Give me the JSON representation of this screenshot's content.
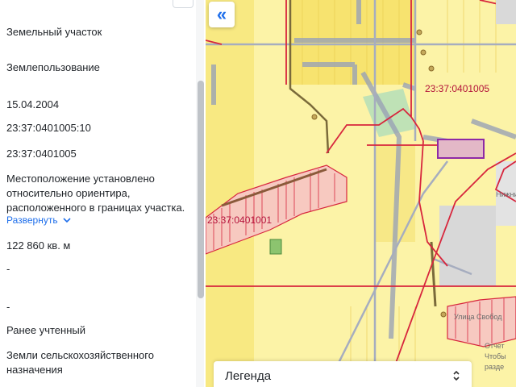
{
  "info_panel": {
    "fields": [
      {
        "value": "Земельный участок"
      },
      {
        "value": "Землепользование"
      },
      {
        "value": "15.04.2004"
      },
      {
        "value": "23:37:0401005:10"
      },
      {
        "value": "23:37:0401005"
      },
      {
        "value": "Местоположение установлено относительно ориентира, расположенного в границах участка."
      },
      {
        "value": "122 860 кв. м"
      },
      {
        "value": "-"
      },
      {
        "value": "-"
      },
      {
        "value": "Ранее учтенный"
      },
      {
        "value": "Земли сельскохозяйственного назначения"
      }
    ],
    "expand_label": "Развернуть"
  },
  "map": {
    "collapse_icon": "«",
    "labels": {
      "quarter_1": "23:37:0401005",
      "quarter_2": "23:37:0401001",
      "place_1": "Нижни",
      "place_2": "Улица Свобод",
      "place_3": "Отчет",
      "place_4": "Чтобы",
      "place_5": "разде"
    },
    "legend_title": "Легенда"
  },
  "colors": {
    "accent": "#1f6feb",
    "boundary_red": "#d7263d",
    "selected_purple": "#8e2aa6",
    "map_yellow": "#fcf3a7"
  }
}
